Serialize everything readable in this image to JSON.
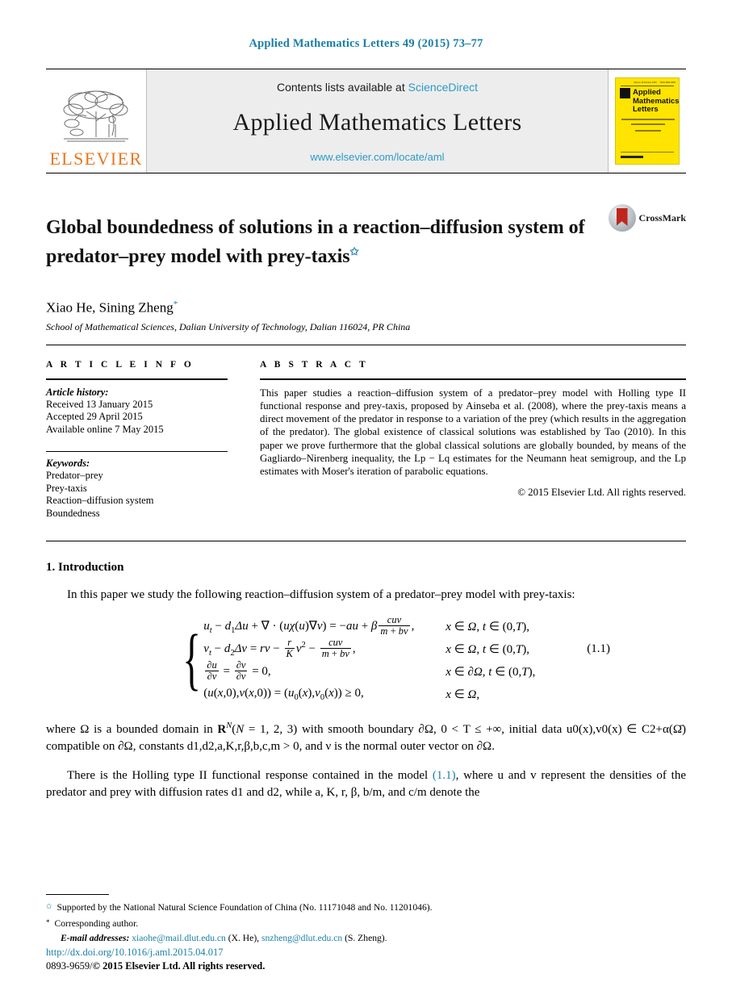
{
  "running_head": "Applied Mathematics Letters 49 (2015) 73–77",
  "masthead": {
    "publisher": "ELSEVIER",
    "contents_prefix": "Contents lists available at ",
    "contents_link": "ScienceDirect",
    "journal_name": "Applied Mathematics Letters",
    "journal_url": "www.elsevier.com/locate/aml",
    "cover": {
      "line1": "Applied",
      "line2": "Mathematics",
      "line3": "Letters",
      "volume_note": "Volume 49  Number 2015",
      "issn_note": "ISSN 0893-9659"
    }
  },
  "title": {
    "line1": "Global boundedness of solutions in a reaction–diffusion system of",
    "line2": "predator–prey model with prey-taxis",
    "footnote_mark": "✩"
  },
  "crossmark": {
    "label": "CrossMark"
  },
  "authors": {
    "names": "Xiao He, Sining Zheng",
    "corresponding_mark": "*",
    "affiliation": "School of Mathematical Sciences, Dalian University of Technology, Dalian 116024, PR China"
  },
  "article_info": {
    "heading": "A R T I C L E    I N F O",
    "history_label": "Article history:",
    "history": [
      "Received 13 January 2015",
      "Accepted 29 April 2015",
      "Available online 7 May 2015"
    ],
    "keywords_label": "Keywords:",
    "keywords": [
      "Predator–prey",
      "Prey-taxis",
      "Reaction–diffusion system",
      "Boundedness"
    ]
  },
  "abstract": {
    "heading": "A B S T R A C T",
    "text": "This paper studies a reaction–diffusion system of a predator–prey model with Holling type II functional response and prey-taxis, proposed by Ainseba et al. (2008), where the prey-taxis means a direct movement of the predator in response to a variation of the prey (which results in the aggregation of the predator). The global existence of classical solutions was established by Tao (2010). In this paper we prove furthermore that the global classical solutions are globally bounded, by means of the Gagliardo–Nirenberg inequality, the Lp − Lq estimates for the Neumann heat semigroup, and the Lp estimates with Moser's iteration of parabolic equations.",
    "copyright": "© 2015 Elsevier Ltd. All rights reserved."
  },
  "body": {
    "section_title": "1.  Introduction",
    "para1": "In this paper we study the following reaction–diffusion system of a predator–prey model with prey-taxis:",
    "equation_number": "(1.1)",
    "para2_a": "where Ω is a bounded domain in ",
    "para2_b": " with smooth boundary ∂Ω, 0 < T ≤ +∞, initial data u0(x),v0(x) ∈ C2+α(Ω̄) compatible on ∂Ω, constants d1,d2,a,K,r,β,b,c,m > 0, and ν is the normal outer vector on ∂Ω.",
    "para3_a": "There is the Holling type II functional response contained in the model ",
    "para3_link": "(1.1)",
    "para3_b": ", where u and v represent the densities of the predator and prey with diffusion rates d1 and d2, while a, K, r, β, b/m, and c/m denote the"
  },
  "footnotes": {
    "funding_mark": "✩",
    "funding": "Supported by the National Natural Science Foundation of China (No. 11171048 and No. 11201046).",
    "corresponding_mark": "*",
    "corresponding": "Corresponding author.",
    "email_label": "E-mail addresses:",
    "email1": "xiaohe@mail.dlut.edu.cn",
    "email1_author": "(X. He),",
    "email2": "snzheng@dlut.edu.cn",
    "email2_author": "(S. Zheng)."
  },
  "bottom": {
    "doi": "http://dx.doi.org/10.1016/j.aml.2015.04.017",
    "issn_prefix": "0893-9659/",
    "issn_rest": "© 2015 Elsevier Ltd. All rights reserved."
  },
  "colors": {
    "link": "#1a7fa8",
    "masthead_link": "#2c9ac9",
    "elsevier_orange": "#E87722",
    "cover_yellow": "#FFE400",
    "crossmark_red": "#c0271c"
  }
}
